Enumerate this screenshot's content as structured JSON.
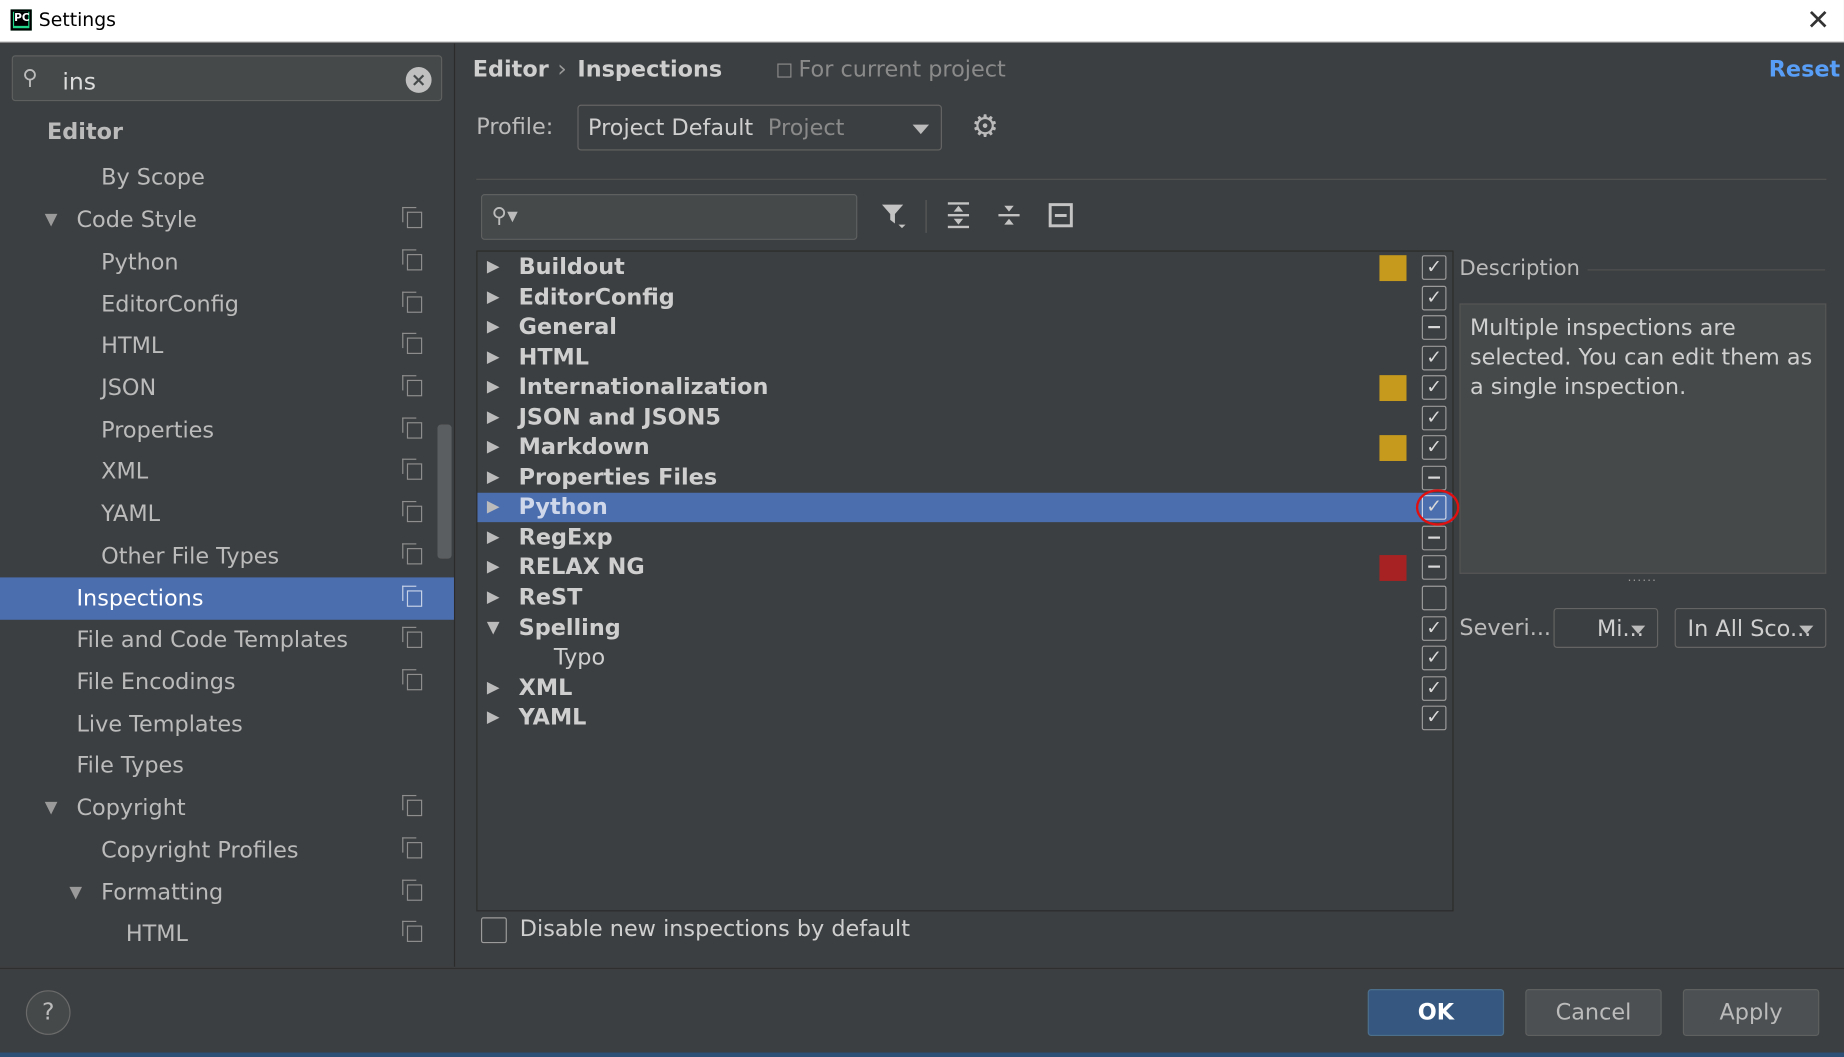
{
  "window": {
    "title": "Settings",
    "close_icon": "close-icon"
  },
  "sidebar": {
    "search_value": "ins",
    "items": [
      {
        "label": "Editor"
      },
      {
        "label": "By Scope"
      },
      {
        "label": "Code Style"
      },
      {
        "label": "Python"
      },
      {
        "label": "EditorConfig"
      },
      {
        "label": "HTML"
      },
      {
        "label": "JSON"
      },
      {
        "label": "Properties"
      },
      {
        "label": "XML"
      },
      {
        "label": "YAML"
      },
      {
        "label": "Other File Types"
      },
      {
        "label": "Inspections"
      },
      {
        "label": "File and Code Templates"
      },
      {
        "label": "File Encodings"
      },
      {
        "label": "Live Templates"
      },
      {
        "label": "File Types"
      },
      {
        "label": "Copyright"
      },
      {
        "label": "Copyright Profiles"
      },
      {
        "label": "Formatting"
      },
      {
        "label": "HTML"
      }
    ]
  },
  "header": {
    "breadcrumb_parent": "Editor",
    "breadcrumb_current": "Inspections",
    "scope_note": "For current project",
    "reset_label": "Reset"
  },
  "profile": {
    "label": "Profile:",
    "value": "Project Default",
    "scope": "Project"
  },
  "inspections": {
    "items": [
      {
        "label": "Buildout",
        "severity_color": "#c59a1d",
        "state": "checked"
      },
      {
        "label": "EditorConfig",
        "severity_color": "",
        "state": "checked"
      },
      {
        "label": "General",
        "severity_color": "",
        "state": "partial"
      },
      {
        "label": "HTML",
        "severity_color": "",
        "state": "checked"
      },
      {
        "label": "Internationalization",
        "severity_color": "#c59a1d",
        "state": "checked"
      },
      {
        "label": "JSON and JSON5",
        "severity_color": "",
        "state": "checked"
      },
      {
        "label": "Markdown",
        "severity_color": "#c59a1d",
        "state": "checked"
      },
      {
        "label": "Properties Files",
        "severity_color": "",
        "state": "partial"
      },
      {
        "label": "Python",
        "severity_color": "",
        "state": "checked",
        "selected": true
      },
      {
        "label": "RegExp",
        "severity_color": "",
        "state": "partial"
      },
      {
        "label": "RELAX NG",
        "severity_color": "#a72323",
        "state": "partial"
      },
      {
        "label": "ReST",
        "severity_color": "",
        "state": "unchecked"
      },
      {
        "label": "Spelling",
        "severity_color": "",
        "state": "checked",
        "expanded": true
      },
      {
        "label": "Typo",
        "severity_color": "",
        "state": "checked",
        "child": true
      },
      {
        "label": "XML",
        "severity_color": "",
        "state": "checked"
      },
      {
        "label": "YAML",
        "severity_color": "",
        "state": "checked"
      }
    ]
  },
  "description": {
    "label": "Description",
    "text": "Multiple inspections are selected. You can edit them as a single inspection."
  },
  "severity": {
    "label": "Severi...",
    "value": "Mi...",
    "scope_value": "In All Sco..."
  },
  "options": {
    "disable_new_label": "Disable new inspections by default"
  },
  "footer": {
    "help_label": "?",
    "ok_label": "OK",
    "cancel_label": "Cancel",
    "apply_label": "Apply"
  },
  "colors": {
    "accent": "#4b6eaf",
    "link": "#589df6",
    "ok_button": "#365880"
  }
}
